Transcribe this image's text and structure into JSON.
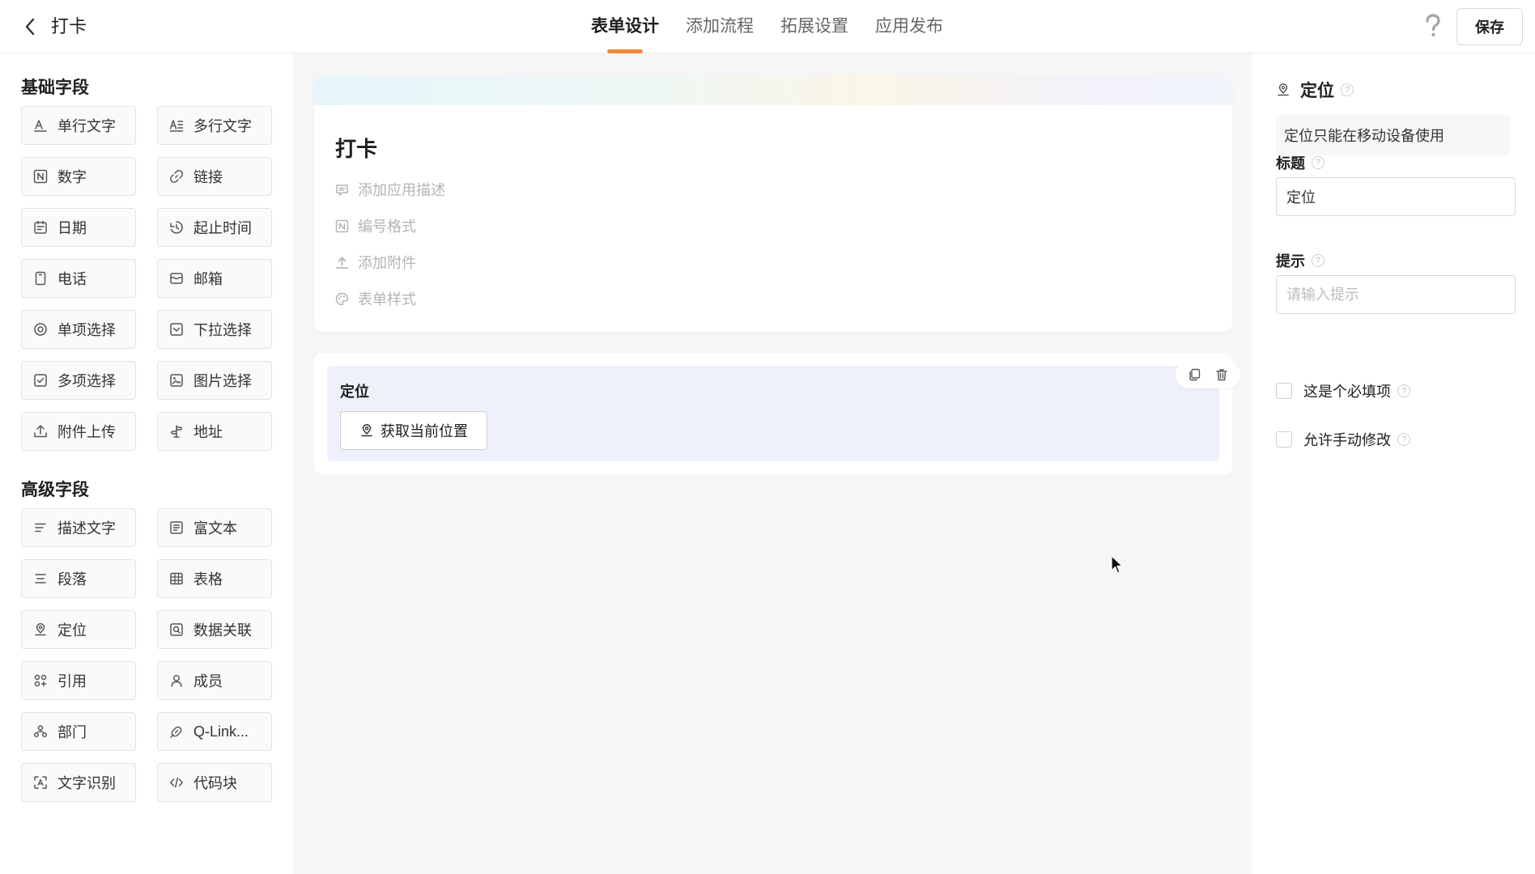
{
  "header": {
    "app_title": "打卡",
    "tabs": [
      {
        "label": "表单设计",
        "active": true
      },
      {
        "label": "添加流程",
        "active": false
      },
      {
        "label": "拓展设置",
        "active": false
      },
      {
        "label": "应用发布",
        "active": false
      }
    ],
    "help_icon": "question-icon",
    "save_label": "保存",
    "accent_color": "#f0883a"
  },
  "left_panel": {
    "basic_title": "基础字段",
    "basic_fields": [
      {
        "label": "单行文字",
        "icon": "single-line-text-icon"
      },
      {
        "label": "多行文字",
        "icon": "multi-line-text-icon"
      },
      {
        "label": "数字",
        "icon": "number-icon"
      },
      {
        "label": "链接",
        "icon": "link-icon"
      },
      {
        "label": "日期",
        "icon": "calendar-icon"
      },
      {
        "label": "起止时间",
        "icon": "time-range-icon"
      },
      {
        "label": "电话",
        "icon": "phone-icon"
      },
      {
        "label": "邮箱",
        "icon": "mail-icon"
      },
      {
        "label": "单项选择",
        "icon": "radio-icon"
      },
      {
        "label": "下拉选择",
        "icon": "dropdown-icon"
      },
      {
        "label": "多项选择",
        "icon": "checkbox-icon"
      },
      {
        "label": "图片选择",
        "icon": "image-icon"
      },
      {
        "label": "附件上传",
        "icon": "upload-icon"
      },
      {
        "label": "地址",
        "icon": "signpost-icon"
      }
    ],
    "advanced_title": "高级字段",
    "advanced_fields": [
      {
        "label": "描述文字",
        "icon": "description-icon"
      },
      {
        "label": "富文本",
        "icon": "rich-text-icon"
      },
      {
        "label": "段落",
        "icon": "paragraph-icon"
      },
      {
        "label": "表格",
        "icon": "table-icon"
      },
      {
        "label": "定位",
        "icon": "location-pin-icon"
      },
      {
        "label": "数据关联",
        "icon": "data-link-icon"
      },
      {
        "label": "引用",
        "icon": "reference-icon"
      },
      {
        "label": "成员",
        "icon": "member-icon"
      },
      {
        "label": "部门",
        "icon": "department-icon"
      },
      {
        "label": "Q-Link...",
        "icon": "q-link-icon"
      },
      {
        "label": "文字识别",
        "icon": "ocr-icon"
      },
      {
        "label": "代码块",
        "icon": "code-icon"
      }
    ]
  },
  "canvas": {
    "form_title": "打卡",
    "meta_items": [
      {
        "label": "添加应用描述",
        "icon": "comment-icon"
      },
      {
        "label": "编号格式",
        "icon": "number-format-icon"
      },
      {
        "label": "添加附件",
        "icon": "attachment-upload-icon"
      },
      {
        "label": "表单样式",
        "icon": "palette-icon"
      }
    ],
    "field": {
      "label": "定位",
      "button_label": "获取当前位置",
      "copy_icon": "copy-icon",
      "delete_icon": "trash-icon"
    }
  },
  "right_panel": {
    "field_type": "定位",
    "notice": "定位只能在移动设备使用",
    "title_label": "标题",
    "title_value": "定位",
    "hint_label": "提示",
    "hint_placeholder": "请输入提示",
    "required_label": "这是个必填项",
    "manual_edit_label": "允许手动修改"
  }
}
